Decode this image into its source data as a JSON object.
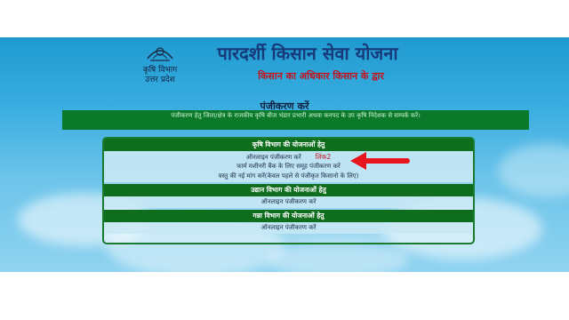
{
  "header": {
    "dept_line1": "कृषि विभाग",
    "dept_line2": "उत्तर प्रदेश",
    "title": "पारदर्शी किसान सेवा योजना",
    "subtitle": "किसान का अधिकार किसान के द्वार"
  },
  "register": {
    "heading": "पंजीकरण करें",
    "notice": "पंजीकरण हेतु जिला/क्षेत्र के राजकीय कृषि बीज भंडार प्रभारी अथवा कनपद के उप कृषि निदेशक से सम्पर्क करें।"
  },
  "sections": [
    {
      "title": "कृषि विभाग की योजनाओं हेतु",
      "items": [
        "ऑनलाइन पंजीकरण करें",
        "फार्म मशीनरी बैंक के लिए समूह पंजीकरण करें",
        "वस्तु की नई मांग करें(केवल पहले से पंजीकृत किसानो के लिए)"
      ],
      "annotation": "लिंक2"
    },
    {
      "title": "उद्यान विभाग की योजनाओं हेतु",
      "items": [
        "ऑनलाइन पंजीकरण करें"
      ]
    },
    {
      "title": "गन्ना विभाग की योजनाओं हेतु",
      "items": [
        "ऑनलाइन पंजीकरण करें"
      ]
    }
  ],
  "colors": {
    "header_green": "#0f6e1e",
    "title_blue": "#163a7a",
    "subtitle_red": "#c0141e",
    "arrow_red": "#e8141e"
  },
  "icons": {
    "logo": "up-emblem-icon",
    "arrow": "red-arrow-icon"
  }
}
